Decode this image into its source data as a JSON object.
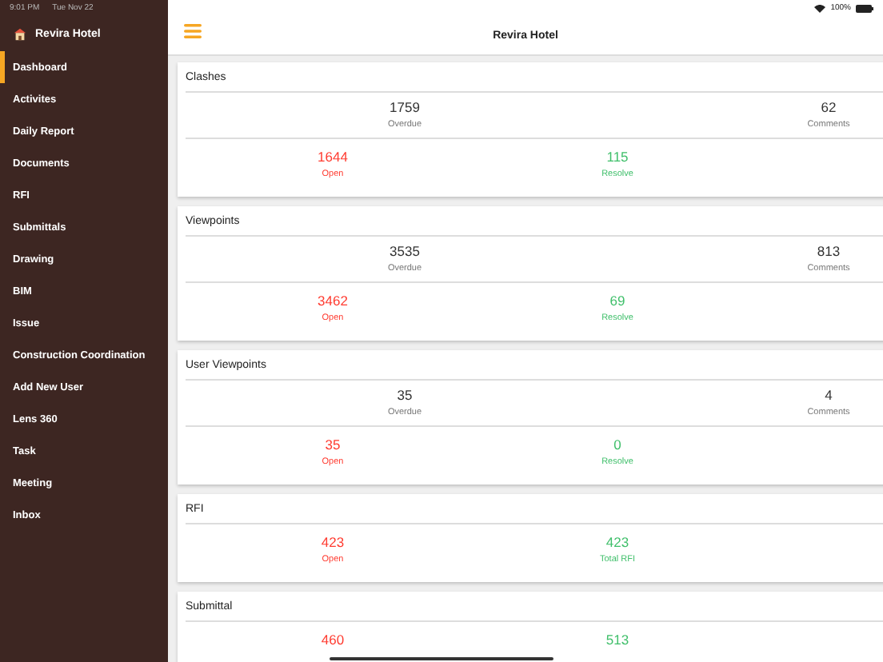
{
  "status_bar": {
    "time": "9:01 PM",
    "date": "Tue Nov 22",
    "battery": "100%"
  },
  "sidebar": {
    "title": "Revira Hotel",
    "items": [
      {
        "label": "Dashboard",
        "selected": true
      },
      {
        "label": "Activites",
        "selected": false
      },
      {
        "label": "Daily Report",
        "selected": false
      },
      {
        "label": "Documents",
        "selected": false
      },
      {
        "label": "RFI",
        "selected": false
      },
      {
        "label": "Submittals",
        "selected": false
      },
      {
        "label": "Drawing",
        "selected": false
      },
      {
        "label": "BIM",
        "selected": false
      },
      {
        "label": "Issue",
        "selected": false
      },
      {
        "label": "Construction Coordination",
        "selected": false
      },
      {
        "label": "Add New User",
        "selected": false
      },
      {
        "label": "Lens 360",
        "selected": false
      },
      {
        "label": "Task",
        "selected": false
      },
      {
        "label": "Meeting",
        "selected": false
      },
      {
        "label": "Inbox",
        "selected": false
      }
    ]
  },
  "header": {
    "title": "Revira Hotel"
  },
  "cards": [
    {
      "title": "Clashes",
      "top": [
        {
          "value": "1759",
          "label": "Overdue"
        },
        {
          "value": "62",
          "label": "Comments"
        }
      ],
      "bottom": [
        {
          "value": "1644",
          "label": "Open",
          "color": "#ff3b30"
        },
        {
          "value": "115",
          "label": "Resolve",
          "color": "#3fbf6a"
        }
      ]
    },
    {
      "title": "Viewpoints",
      "top": [
        {
          "value": "3535",
          "label": "Overdue"
        },
        {
          "value": "813",
          "label": "Comments"
        }
      ],
      "bottom": [
        {
          "value": "3462",
          "label": "Open",
          "color": "#ff3b30"
        },
        {
          "value": "69",
          "label": "Resolve",
          "color": "#3fbf6a"
        }
      ]
    },
    {
      "title": "User Viewpoints",
      "top": [
        {
          "value": "35",
          "label": "Overdue"
        },
        {
          "value": "4",
          "label": "Comments"
        }
      ],
      "bottom": [
        {
          "value": "35",
          "label": "Open",
          "color": "#ff3b30"
        },
        {
          "value": "0",
          "label": "Resolve",
          "color": "#3fbf6a"
        }
      ]
    },
    {
      "title": "RFI",
      "bottom": [
        {
          "value": "423",
          "label": "Open",
          "color": "#ff3b30"
        },
        {
          "value": "423",
          "label": "Total RFI",
          "color": "#3fbf6a"
        }
      ]
    },
    {
      "title": "Submittal",
      "bottom": [
        {
          "value": "460",
          "color": "#ff3b30"
        },
        {
          "value": "513",
          "color": "#3fbf6a"
        }
      ]
    }
  ]
}
